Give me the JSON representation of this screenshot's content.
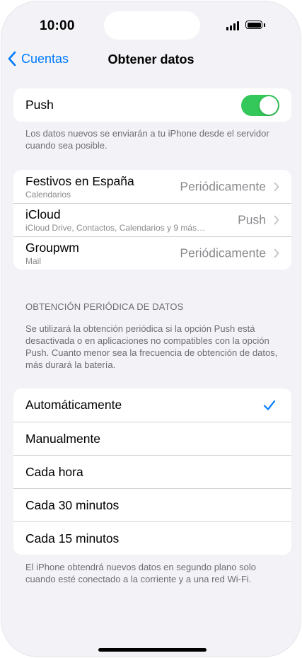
{
  "status_bar": {
    "time": "10:00",
    "signal_icon": "cellular-signal-icon",
    "battery_icon": "battery-icon",
    "battery_level": 1.0
  },
  "nav": {
    "back_label": "Cuentas",
    "title": "Obtener datos"
  },
  "push": {
    "label": "Push",
    "enabled": true,
    "footnote": "Los datos nuevos se enviarán a tu iPhone desde el servidor cuando sea posible.",
    "accent": "#34c759"
  },
  "accounts": [
    {
      "name": "Festivos en España",
      "subtitle": "Calendarios",
      "value": "Periódicamente"
    },
    {
      "name": "iCloud",
      "subtitle": "iCloud Drive, Contactos, Calendarios y 9 más…",
      "value": "Push"
    },
    {
      "name": "Groupwm",
      "subtitle": "Mail",
      "value": "Periódicamente"
    }
  ],
  "fetch": {
    "header": "OBTENCIÓN PERIÓDICA DE DATOS",
    "description": "Se utilizará la obtención periódica si la opción Push está desactivada o en aplicaciones no compatibles con la opción Push. Cuanto menor sea la frecuencia de obtención de datos, más durará la batería.",
    "options": [
      {
        "label": "Automáticamente",
        "selected": true
      },
      {
        "label": "Manualmente",
        "selected": false
      },
      {
        "label": "Cada hora",
        "selected": false
      },
      {
        "label": "Cada 30 minutos",
        "selected": false
      },
      {
        "label": "Cada 15 minutos",
        "selected": false
      }
    ],
    "footnote": "El iPhone obtendrá nuevos datos en segundo plano solo cuando esté conectado a la corriente y a una red Wi-Fi.",
    "accent": "#007aff"
  }
}
